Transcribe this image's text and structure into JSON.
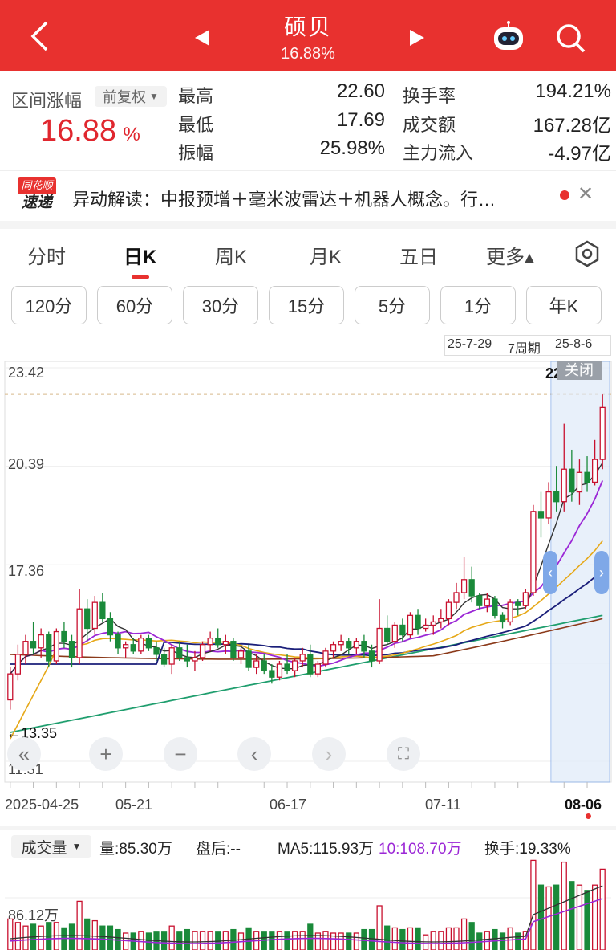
{
  "header": {
    "back_icon": "chevron-left-icon",
    "title": "硕贝",
    "subtitle": "16.88%",
    "prev_icon": "triangle-left-icon",
    "next_icon": "triangle-right-icon",
    "robot_icon": "robot-icon",
    "search_icon": "search-icon"
  },
  "stats": {
    "range_label": "区间涨幅",
    "adjust_label": "前复权",
    "range_value": "16.88",
    "range_unit": "%",
    "high_label": "最高",
    "high_value": "22.60",
    "low_label": "最低",
    "low_value": "17.69",
    "amp_label": "振幅",
    "amp_value": "25.98%",
    "turnover_label": "换手率",
    "turnover_value": "194.21%",
    "volume_amt_label": "成交额",
    "volume_amt_value": "167.28亿",
    "mainflow_label": "主力流入",
    "mainflow_value": "-4.97亿"
  },
  "news": {
    "badge_top": "同花顺",
    "badge_bottom": "速递",
    "text": "异动解读：中报预增＋毫米波雷达＋机器人概念。行…"
  },
  "tabs": [
    "分时",
    "日K",
    "周K",
    "月K",
    "五日",
    "更多▴"
  ],
  "active_tab": "日K",
  "periods": [
    "120分",
    "60分",
    "30分",
    "15分",
    "5分",
    "1分",
    "年K"
  ],
  "range_bar": {
    "start": "25-7-29",
    "mid": "7周期",
    "end": "25-8-6",
    "close": "关闭"
  },
  "price_axis": {
    "top": "23.42",
    "mid1": "20.39",
    "mid2": "17.36",
    "bottom": "11.31",
    "low_marker": "←13.35",
    "partial_right": "22"
  },
  "date_axis": [
    "2025-04-25",
    "05-21",
    "06-17",
    "07-11",
    "08-06"
  ],
  "volume": {
    "label": "成交量",
    "vol": "量:85.30万",
    "after": "盘后:--",
    "ma5": "MA5:115.93万",
    "ma10": "10:108.70万",
    "turnover": "换手:19.33%",
    "axis_value": "86.12万"
  },
  "colors": {
    "accent": "#e8312f",
    "up": "#c8102e",
    "down": "#1a8a3a",
    "ma5": "#333333",
    "ma10": "#9b27d6",
    "ma20": "#e6a817",
    "ma30": "#1b1f7a",
    "ma60": "#8b3a1a",
    "ma120": "#1f9e6e"
  },
  "chart_data": {
    "type": "candlestick",
    "x_start": "2025-04-25",
    "x_end": "2025-08-06",
    "ylim": [
      11.31,
      23.42
    ],
    "ohlc": [
      [
        13.2,
        14.2,
        12.9,
        14.0
      ],
      [
        14.0,
        14.9,
        13.8,
        14.6
      ],
      [
        14.6,
        15.2,
        14.3,
        15.0
      ],
      [
        15.0,
        15.6,
        14.6,
        14.8
      ],
      [
        14.8,
        15.4,
        14.5,
        15.2
      ],
      [
        15.2,
        15.3,
        14.2,
        14.4
      ],
      [
        14.4,
        15.4,
        14.3,
        15.3
      ],
      [
        15.3,
        15.6,
        14.8,
        15.0
      ],
      [
        15.0,
        15.2,
        14.2,
        14.5
      ],
      [
        14.5,
        16.6,
        14.3,
        16.0
      ],
      [
        16.0,
        16.3,
        15.0,
        15.4
      ],
      [
        15.4,
        16.4,
        15.2,
        16.2
      ],
      [
        16.2,
        16.5,
        15.6,
        15.7
      ],
      [
        15.7,
        15.9,
        15.0,
        15.2
      ],
      [
        15.2,
        15.3,
        14.6,
        14.8
      ],
      [
        14.8,
        15.0,
        14.5,
        14.9
      ],
      [
        14.9,
        15.1,
        14.6,
        14.7
      ],
      [
        14.7,
        15.2,
        14.6,
        15.1
      ],
      [
        15.1,
        15.2,
        14.7,
        14.8
      ],
      [
        14.8,
        15.0,
        14.4,
        14.6
      ],
      [
        14.6,
        14.8,
        14.2,
        14.3
      ],
      [
        14.3,
        14.9,
        14.0,
        14.8
      ],
      [
        14.8,
        15.0,
        14.4,
        14.5
      ],
      [
        14.5,
        14.9,
        14.2,
        14.4
      ],
      [
        14.4,
        14.7,
        14.1,
        14.5
      ],
      [
        14.5,
        15.0,
        14.4,
        14.9
      ],
      [
        14.9,
        15.3,
        14.7,
        15.1
      ],
      [
        15.1,
        15.4,
        14.8,
        14.9
      ],
      [
        14.9,
        15.2,
        14.6,
        15.0
      ],
      [
        15.0,
        15.1,
        14.4,
        14.5
      ],
      [
        14.5,
        14.8,
        14.3,
        14.7
      ],
      [
        14.7,
        14.9,
        14.1,
        14.2
      ],
      [
        14.2,
        14.6,
        14.0,
        14.4
      ],
      [
        14.4,
        14.6,
        14.0,
        14.1
      ],
      [
        14.1,
        14.3,
        13.7,
        13.9
      ],
      [
        13.9,
        14.4,
        13.8,
        14.3
      ],
      [
        14.3,
        14.6,
        14.0,
        14.1
      ],
      [
        14.1,
        14.5,
        13.9,
        14.4
      ],
      [
        14.4,
        14.8,
        14.2,
        14.6
      ],
      [
        14.6,
        14.9,
        13.9,
        14.0
      ],
      [
        14.0,
        14.4,
        13.9,
        14.3
      ],
      [
        14.3,
        14.8,
        14.2,
        14.7
      ],
      [
        14.7,
        15.0,
        14.5,
        14.9
      ],
      [
        14.9,
        15.2,
        14.7,
        15.0
      ],
      [
        15.0,
        15.1,
        14.6,
        14.8
      ],
      [
        14.8,
        15.1,
        14.6,
        15.0
      ],
      [
        15.0,
        15.2,
        14.5,
        14.7
      ],
      [
        14.7,
        14.9,
        14.2,
        14.4
      ],
      [
        14.4,
        16.3,
        14.3,
        15.4
      ],
      [
        15.4,
        15.8,
        14.9,
        15.0
      ],
      [
        15.0,
        15.6,
        14.8,
        15.5
      ],
      [
        15.5,
        15.7,
        15.0,
        15.2
      ],
      [
        15.2,
        15.9,
        15.1,
        15.8
      ],
      [
        15.8,
        16.0,
        15.2,
        15.4
      ],
      [
        15.4,
        15.7,
        15.3,
        15.5
      ],
      [
        15.5,
        15.8,
        15.2,
        15.6
      ],
      [
        15.6,
        16.0,
        15.4,
        15.7
      ],
      [
        15.7,
        16.3,
        15.5,
        16.2
      ],
      [
        16.2,
        16.8,
        16.0,
        16.5
      ],
      [
        16.5,
        17.6,
        16.3,
        16.9
      ],
      [
        16.9,
        17.3,
        16.2,
        16.4
      ],
      [
        16.4,
        16.5,
        16.0,
        16.1
      ],
      [
        16.1,
        16.5,
        15.9,
        16.3
      ],
      [
        16.3,
        16.4,
        15.7,
        15.8
      ],
      [
        15.8,
        15.9,
        15.4,
        15.6
      ],
      [
        15.6,
        16.3,
        15.5,
        16.2
      ],
      [
        16.2,
        16.3,
        15.8,
        16.1
      ],
      [
        16.1,
        16.6,
        16.0,
        16.5
      ],
      [
        16.5,
        19.2,
        16.4,
        19.0
      ],
      [
        19.0,
        19.6,
        18.2,
        18.8
      ],
      [
        18.8,
        19.9,
        18.6,
        19.6
      ],
      [
        19.6,
        20.4,
        19.0,
        19.3
      ],
      [
        19.3,
        21.7,
        19.0,
        20.3
      ],
      [
        20.3,
        20.9,
        19.3,
        19.6
      ],
      [
        19.6,
        20.6,
        19.2,
        20.2
      ],
      [
        20.2,
        20.7,
        19.6,
        19.9
      ],
      [
        19.9,
        21.2,
        19.8,
        20.6
      ],
      [
        20.6,
        22.6,
        20.3,
        22.2
      ]
    ],
    "ma_lines": [
      "MA5",
      "MA10",
      "MA20",
      "MA30",
      "MA60",
      "MA120"
    ]
  }
}
